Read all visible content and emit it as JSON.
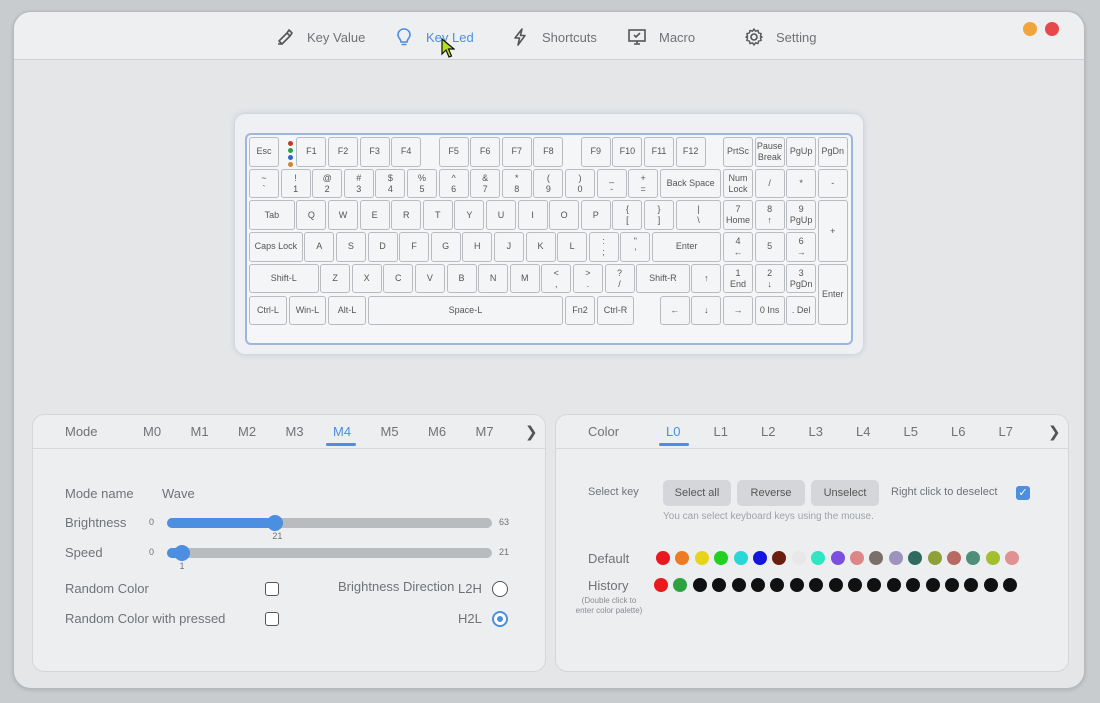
{
  "nav": [
    {
      "label": "Key Value",
      "icon": "key-value-icon"
    },
    {
      "label": "Key Led",
      "icon": "bulb-icon"
    },
    {
      "label": "Shortcuts",
      "icon": "lightning-icon"
    },
    {
      "label": "Macro",
      "icon": "monitor-icon"
    },
    {
      "label": "Setting",
      "icon": "gear-icon"
    }
  ],
  "window_buttons": {
    "minimize_color": "#f0a53b",
    "close_color": "#e8484a"
  },
  "accent": "#4c8ee0",
  "keyboard": {
    "row0": [
      "Esc",
      "F1",
      "F2",
      "F3",
      "F4",
      "F5",
      "F6",
      "F7",
      "F8",
      "F9",
      "F10",
      "F11",
      "F12",
      "PrtSc",
      "Pause\nBreak",
      "PgUp",
      "PgDn"
    ],
    "row1": [
      "~\n`",
      "!\n1",
      "@\n2",
      "#\n3",
      "$\n4",
      "%\n5",
      "^\n6",
      "&\n7",
      "*\n8",
      "(\n9",
      ")\n0",
      "_\n-",
      "+\n=",
      "Back Space",
      "Num\nLock",
      "/",
      "*",
      "-"
    ],
    "row2": [
      "Tab",
      "Q",
      "W",
      "E",
      "R",
      "T",
      "Y",
      "U",
      "I",
      "O",
      "P",
      "{\n[",
      "}\n]",
      "|\n\\",
      "7\nHome",
      "8\n↑",
      "9\nPgUp",
      "+"
    ],
    "row3": [
      "Caps Lock",
      "A",
      "S",
      "D",
      "F",
      "G",
      "H",
      "J",
      "K",
      "L",
      ":\n;",
      "\"\n'",
      "Enter",
      "4\n←",
      "5",
      "6\n→"
    ],
    "row4": [
      "Shift-L",
      "Z",
      "X",
      "C",
      "V",
      "B",
      "N",
      "M",
      "<\n,",
      ">\n.",
      "?\n/",
      "Shift-R",
      "↑",
      "1\nEnd",
      "2\n↓",
      "3\nPgDn",
      "Enter"
    ],
    "row5": [
      "Ctrl-L",
      "Win-L",
      "Alt-L",
      "Space-L",
      "Fn2",
      "Ctrl-R",
      "←",
      "↓",
      "→",
      "0 Ins",
      ". Del"
    ],
    "led_colors": [
      "#c0392b",
      "#2e9e49",
      "#2f64c8",
      "#d0813a"
    ]
  },
  "mode_panel": {
    "title": "Mode",
    "tabs": [
      "M0",
      "M1",
      "M2",
      "M3",
      "M4",
      "M5",
      "M6",
      "M7"
    ],
    "active_tab": "M4",
    "mode_name_label": "Mode name",
    "mode_name_value": "Wave",
    "brightness": {
      "label": "Brightness",
      "min": "0",
      "max": "63",
      "value": "21",
      "fraction": 0.3333
    },
    "speed": {
      "label": "Speed",
      "min": "0",
      "max": "21",
      "value": "1",
      "fraction": 0.0476
    },
    "random_color_label": "Random Color",
    "random_color_pressed_label": "Random Color with pressed",
    "direction_label": "Brightness Direction",
    "l2h_label": "L2H",
    "h2l_label": "H2L",
    "selected_direction": "H2L"
  },
  "color_panel": {
    "title": "Color",
    "tabs": [
      "L0",
      "L1",
      "L2",
      "L3",
      "L4",
      "L5",
      "L6",
      "L7"
    ],
    "active_tab": "L0",
    "select_key_label": "Select key",
    "select_all": "Select all",
    "reverse": "Reverse",
    "unselect": "Unselect",
    "right_click_label": "Right click to deselect",
    "right_click_checked": true,
    "hint": "You can select keyboard keys using the mouse.",
    "default_label": "Default",
    "default_colors": [
      "#e8191f",
      "#ee7a22",
      "#e8d31b",
      "#22d022",
      "#29d7d7",
      "#1515e0",
      "#6b1d10",
      "#e8e8e8",
      "#2ee6c4",
      "#7b4fe0",
      "#dc8787",
      "#7a6f6a",
      "#9d93bd",
      "#2e6b5e",
      "#8fa037",
      "#b86a62",
      "#4f8f7a",
      "#a3be2f",
      "#e09292"
    ],
    "history_label": "History",
    "history_note": "(Double click to\nenter color palette)",
    "history_colors": [
      "#e8191f",
      "#2ea23f",
      "#111111",
      "#111111",
      "#111111",
      "#111111",
      "#111111",
      "#111111",
      "#111111",
      "#111111",
      "#111111",
      "#111111",
      "#111111",
      "#111111",
      "#111111",
      "#111111",
      "#111111",
      "#111111",
      "#111111"
    ]
  }
}
